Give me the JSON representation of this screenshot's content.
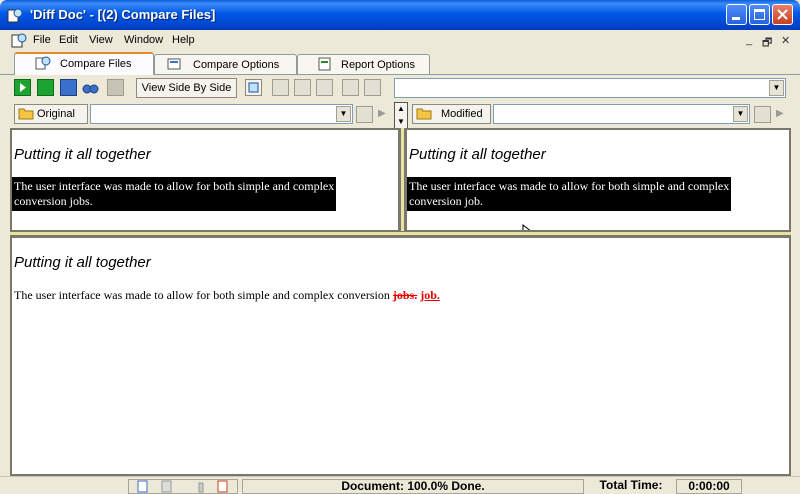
{
  "window": {
    "title": "'Diff Doc' - [(2) Compare Files]"
  },
  "menu": [
    "File",
    "Edit",
    "View",
    "Window",
    "Help"
  ],
  "mdi_controls": [
    "_",
    "🗗",
    "✕"
  ],
  "tabs": [
    {
      "label": "Compare Files",
      "active": true
    },
    {
      "label": "Compare Options",
      "active": false
    },
    {
      "label": "Report Options",
      "active": false
    }
  ],
  "toolbar": {
    "view_side_by_side": "View Side By Side",
    "combo_value": ""
  },
  "original": {
    "label": "Original",
    "path": ""
  },
  "modified": {
    "label": "Modified",
    "path": ""
  },
  "left_pane": {
    "heading": "Putting it all together",
    "line1": "The user interface was made to allow for both simple and complex",
    "line2": "conversion jobs."
  },
  "right_pane": {
    "heading": "Putting it all together",
    "line1": "The user interface was made to allow for both simple and complex",
    "line2": "conversion job."
  },
  "merged_pane": {
    "heading": "Putting it all together",
    "text": "The user interface was made to allow for both simple and complex conversion",
    "deleted": "jobs.",
    "inserted": "job."
  },
  "status": {
    "document": "Document: 100.0% Done.",
    "total_time_label": "Total Time:",
    "total_time": "0:00:00"
  }
}
